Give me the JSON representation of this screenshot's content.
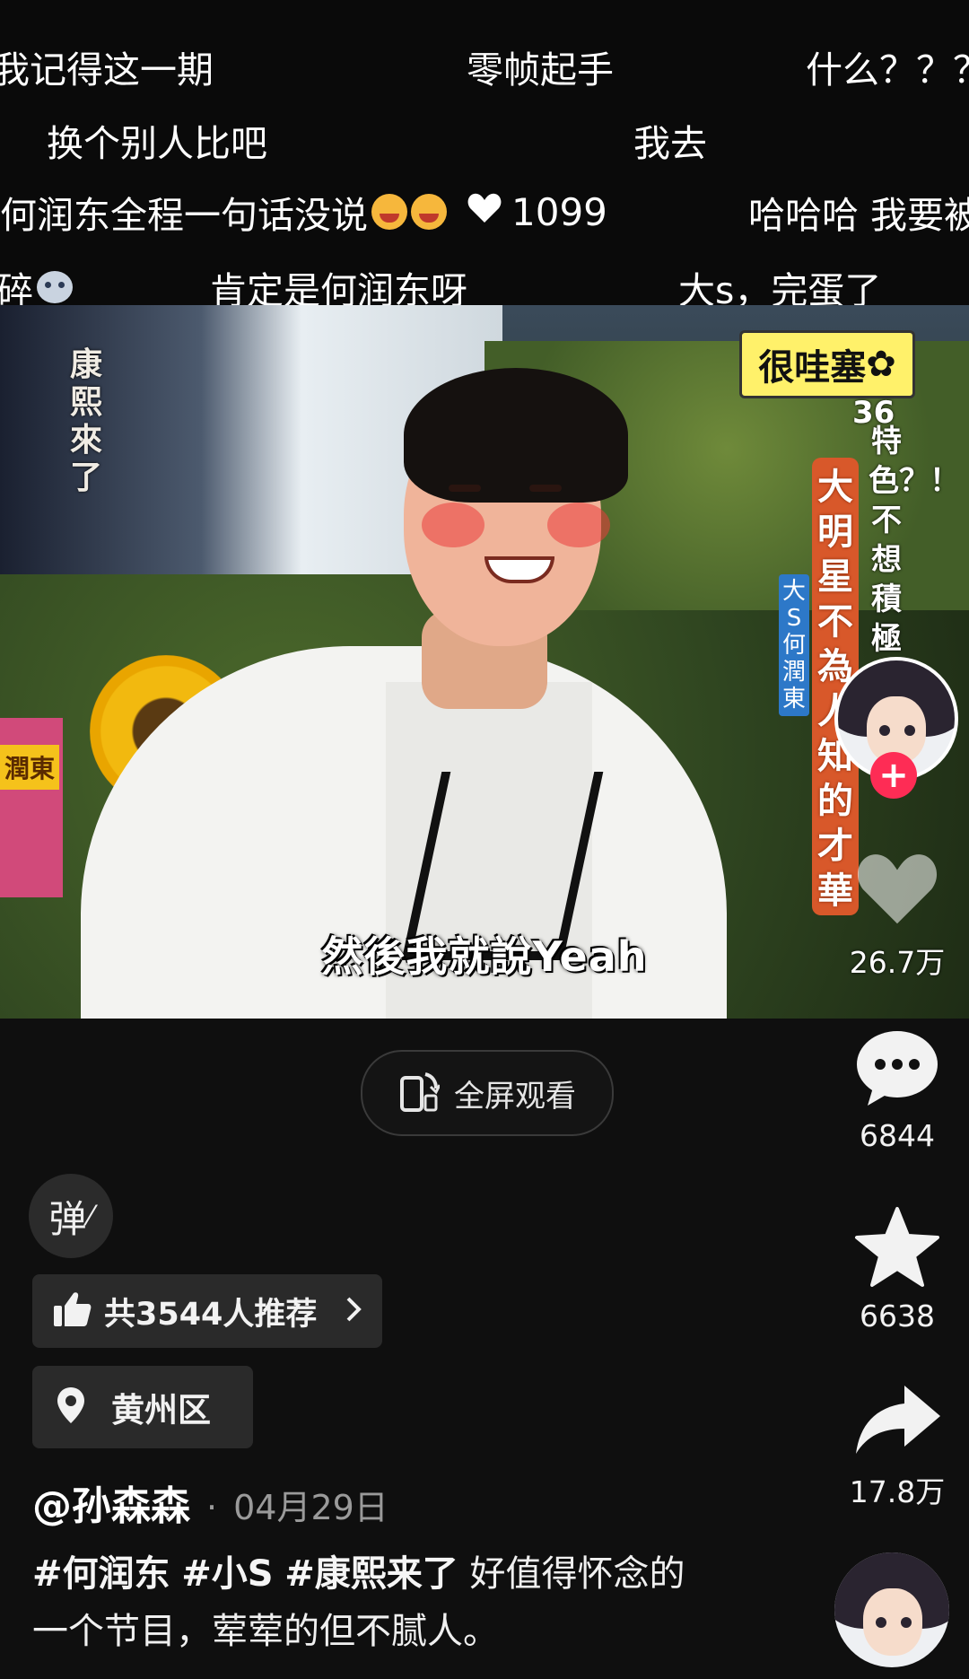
{
  "danmaku": [
    {
      "text": "我记得这一期",
      "row": 0
    },
    {
      "text": "零帧起手",
      "row": 0
    },
    {
      "text": "什么？？？",
      "row": 0
    },
    {
      "text": "换个别人比吧",
      "row": 1
    },
    {
      "text": "我去",
      "row": 1
    },
    {
      "text": "何润东全程一句话没说",
      "row": 2,
      "emoji_count": 2,
      "likes": "1099"
    },
    {
      "text": "哈哈哈 我要被",
      "row": 2
    },
    {
      "text": "碎",
      "row": 3
    },
    {
      "text": "肯定是何润东呀",
      "row": 3
    },
    {
      "text": "大s，完蛋了",
      "row": 3
    }
  ],
  "video": {
    "side_label": "康熙來了",
    "badge": "很哇塞",
    "banner_number": "36",
    "banner_text": "大明星不為人知的才華",
    "banner_side": "特色？！不想積極表現",
    "guest_labels": "大S 何潤東",
    "cup_label": "潤東",
    "subtitle": "然後我就說Yeah"
  },
  "fullscreen": {
    "label": "全屏观看",
    "icon": "rotate-screen-icon"
  },
  "rail": {
    "like_count": "26.7万",
    "comment_count": "6844",
    "favorite_count": "6638",
    "share_count": "17.8万"
  },
  "danmu_toggle": {
    "label": "弹"
  },
  "recommend": {
    "label": "共3544人推荐",
    "icon": "thumbs-up-icon"
  },
  "location": {
    "label": "黄州区",
    "icon": "location-pin-icon"
  },
  "post": {
    "author": "@孙森森",
    "date": "04月29日",
    "tags": [
      "#何润东",
      "#小S",
      "#康熙来了"
    ],
    "text_line1": "好值得怀念的",
    "text_line2": "一个节目，荤荤的但不腻人。"
  },
  "colors": {
    "background": "#0f0f0f",
    "follow_plus": "#fe2c55",
    "banner": "#d8582a",
    "badge": "#fff16a"
  }
}
